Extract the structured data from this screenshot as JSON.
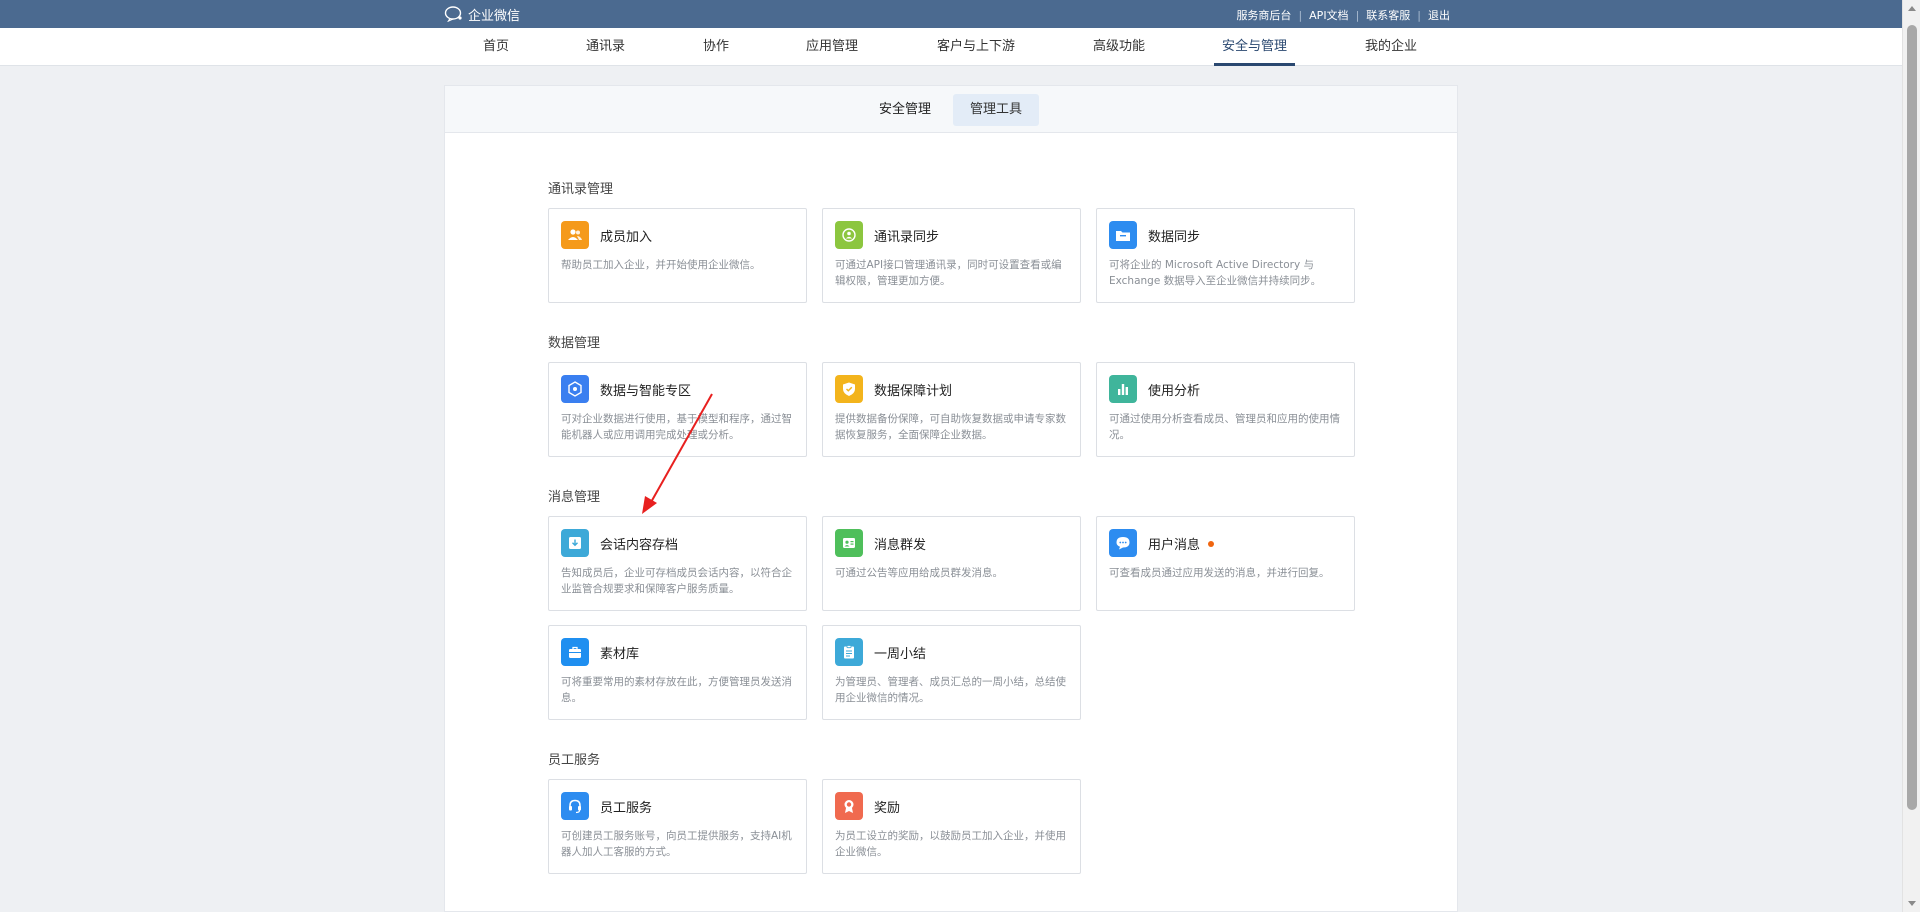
{
  "topbar": {
    "brand": "企业微信",
    "links": [
      "服务商后台",
      "API文档",
      "联系客服",
      "退出"
    ]
  },
  "nav": {
    "items": [
      "首页",
      "通讯录",
      "协作",
      "应用管理",
      "客户与上下游",
      "高级功能",
      "安全与管理",
      "我的企业"
    ],
    "active": "安全与管理"
  },
  "subtabs": {
    "items": [
      "安全管理",
      "管理工具"
    ],
    "active": "管理工具"
  },
  "sections": [
    {
      "title": "通讯录管理",
      "cards": [
        {
          "title": "成员加入",
          "desc": "帮助员工加入企业，并开始使用企业微信。",
          "icon": "members-icon",
          "color": "#f59a1b"
        },
        {
          "title": "通讯录同步",
          "desc": "可通过API接口管理通讯录，同时可设置查看或编辑权限，管理更加方便。",
          "icon": "sync-icon",
          "color": "#8cc63f"
        },
        {
          "title": "数据同步",
          "desc": "可将企业的 Microsoft Active Directory 与 Exchange 数据导入至企业微信并持续同步。",
          "icon": "folder-icon",
          "color": "#2d8cf0"
        }
      ]
    },
    {
      "title": "数据管理",
      "cards": [
        {
          "title": "数据与智能专区",
          "desc": "可对企业数据进行使用，基于模型和程序，通过智能机器人或应用调用完成处理或分析。",
          "icon": "hexagon-icon",
          "color": "#3a7ff0"
        },
        {
          "title": "数据保障计划",
          "desc": "提供数据备份保障，可自助恢复数据或申请专家数据恢复服务，全面保障企业数据。",
          "icon": "shield-icon",
          "color": "#f3b41c"
        },
        {
          "title": "使用分析",
          "desc": "可通过使用分析查看成员、管理员和应用的使用情况。",
          "icon": "bar-chart-icon",
          "color": "#3fb59b"
        }
      ]
    },
    {
      "title": "消息管理",
      "cards": [
        {
          "title": "会话内容存档",
          "desc": "告知成员后，企业可存档成员会话内容，以符合企业监管合规要求和保障客户服务质量。",
          "icon": "archive-icon",
          "color": "#3da9d8"
        },
        {
          "title": "消息群发",
          "desc": "可通过公告等应用给成员群发消息。",
          "icon": "broadcast-icon",
          "color": "#4fbf5b"
        },
        {
          "title": "用户消息",
          "desc": "可查看成员通过应用发送的消息，并进行回复。",
          "icon": "chat-bubble-icon",
          "color": "#2d8cf0",
          "badge": true
        },
        {
          "title": "素材库",
          "desc": "可将重要常用的素材存放在此，方便管理员发送消息。",
          "icon": "briefcase-icon",
          "color": "#1f8ff0"
        },
        {
          "title": "一周小结",
          "desc": "为管理员、管理者、成员汇总的一周小结，总结使用企业微信的情况。",
          "icon": "clipboard-icon",
          "color": "#3da9d8"
        }
      ]
    },
    {
      "title": "员工服务",
      "cards": [
        {
          "title": "员工服务",
          "desc": "可创建员工服务账号，向员工提供服务，支持AI机器人加人工客服的方式。",
          "icon": "headset-icon",
          "color": "#2d8cf0"
        },
        {
          "title": "奖励",
          "desc": "为员工设立的奖励，以鼓励员工加入企业，并使用企业微信。",
          "icon": "award-icon",
          "color": "#f06a4f"
        }
      ]
    }
  ]
}
